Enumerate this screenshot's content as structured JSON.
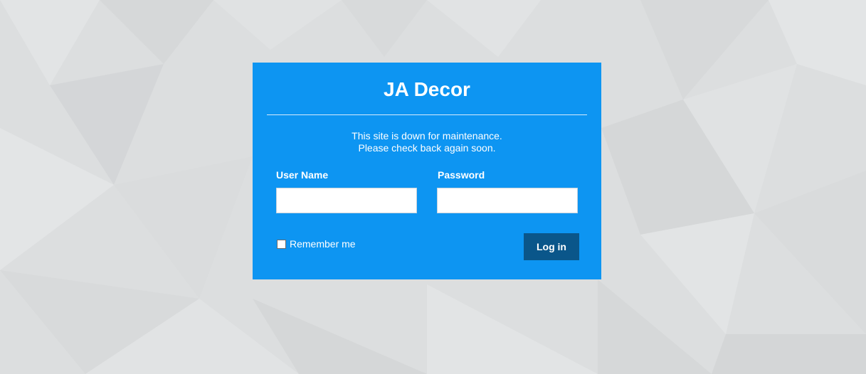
{
  "site": {
    "title": "JA Decor"
  },
  "maintenance": {
    "line1": "This site is down for maintenance.",
    "line2": "Please check back again soon."
  },
  "form": {
    "username_label": "User Name",
    "username_value": "",
    "password_label": "Password",
    "password_value": "",
    "remember_label": "Remember me",
    "remember_checked": false,
    "login_label": "Log in"
  },
  "colors": {
    "panel": "#0d95f2",
    "button": "#0a568a",
    "background": "#dcdedf",
    "text": "#ffffff"
  }
}
